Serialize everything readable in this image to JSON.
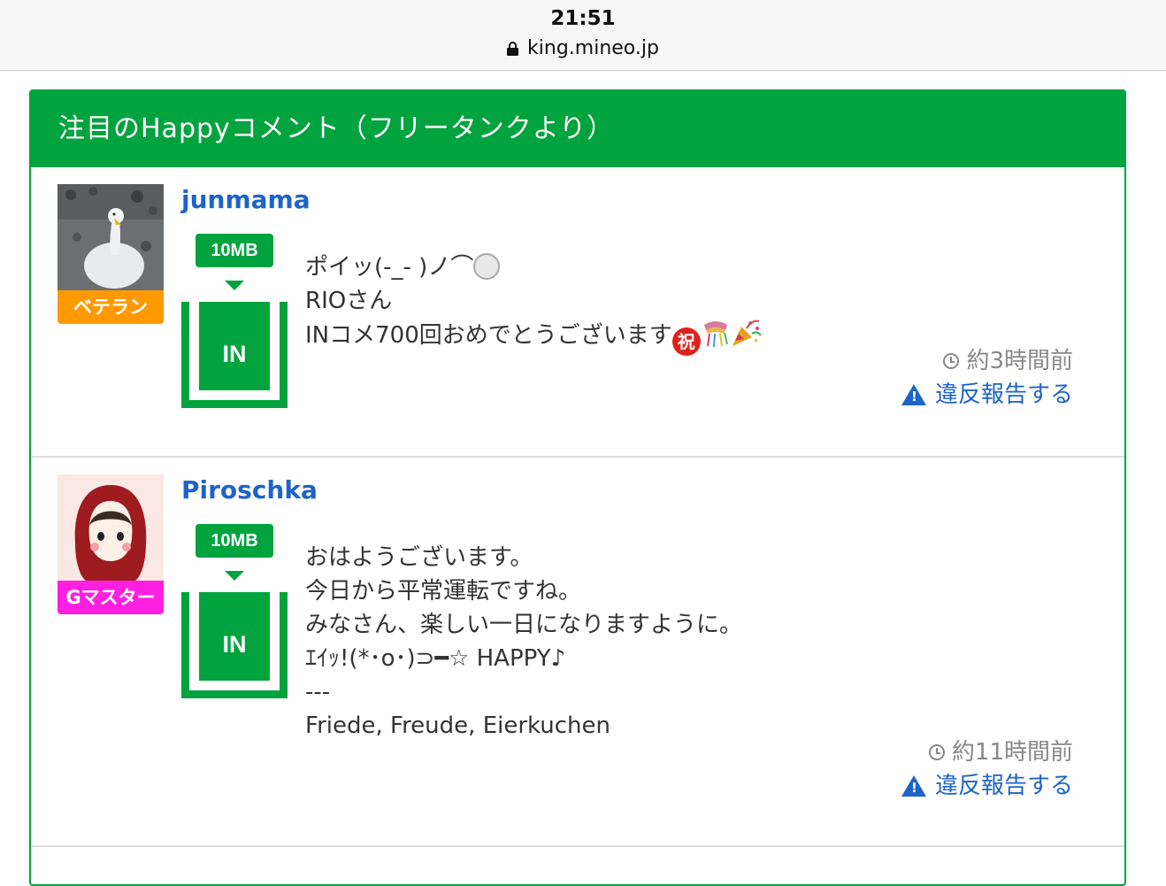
{
  "status_bar": {
    "time": "21:51",
    "url": "king.mineo.jp"
  },
  "panel": {
    "title": "注目のHappyコメント（フリータンクより）",
    "comments": [
      {
        "username": "junmama",
        "rank": "ベテラン",
        "rank_color": "#ff9900",
        "mb": "10MB",
        "direction": "IN",
        "lines": [
          "ポイッ(-_- )ノ⌒",
          "RIOさん",
          "INコメ700回おめでとうございます"
        ],
        "emojis": [
          "volleyball-emoji",
          "iwai-emoji",
          "kusudama-emoji",
          "party-popper-emoji"
        ],
        "iwai_glyph": "祝",
        "time": "約3時間前",
        "report": "違反報告する"
      },
      {
        "username": "Piroschka",
        "rank": "Gマスター",
        "rank_color": "#ff1fe0",
        "mb": "10MB",
        "direction": "IN",
        "lines": [
          "おはようございます。",
          "今日から平常運転ですね。",
          "みなさん、楽しい一日になりますように。",
          "ｴｲｯ!(*･o･)⊃━☆ HAPPY♪",
          "---",
          "Friede, Freude, Eierkuchen"
        ],
        "time": "約11時間前",
        "report": "違反報告する"
      }
    ]
  },
  "colors": {
    "brand_green": "#00a33e",
    "link_blue": "#1e64c8"
  }
}
